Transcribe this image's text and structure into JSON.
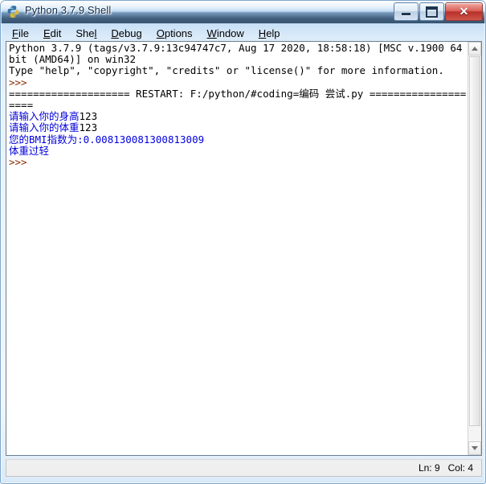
{
  "window": {
    "title": "Python 3.7.9 Shell",
    "icon": "python-logo-icon",
    "controls": {
      "minimize_label": "Minimize",
      "maximize_label": "Maximize",
      "close_label": "✕"
    }
  },
  "menubar": {
    "items": [
      {
        "name": "file",
        "pre": "",
        "key": "F",
        "post": "ile"
      },
      {
        "name": "edit",
        "pre": "",
        "key": "E",
        "post": "dit"
      },
      {
        "name": "shell",
        "pre": "She",
        "key": "l",
        "post": ""
      },
      {
        "name": "debug",
        "pre": "",
        "key": "D",
        "post": "ebug"
      },
      {
        "name": "options",
        "pre": "",
        "key": "O",
        "post": "ptions"
      },
      {
        "name": "window",
        "pre": "",
        "key": "W",
        "post": "indow"
      },
      {
        "name": "help",
        "pre": "",
        "key": "H",
        "post": "elp"
      }
    ]
  },
  "console": {
    "lines": [
      {
        "segments": [
          {
            "text": "Python 3.7.9 (tags/v3.7.9:13c94747c7, Aug 17 2020, 18:58:18) [MSC v.1900 64 bit (AMD64)] on win32",
            "color": "black"
          }
        ]
      },
      {
        "segments": [
          {
            "text": "Type \"help\", \"copyright\", \"credits\" or \"license()\" for more information.",
            "color": "black"
          }
        ]
      },
      {
        "segments": [
          {
            "text": ">>> ",
            "color": "prompt"
          }
        ]
      },
      {
        "segments": [
          {
            "text": "==================== RESTART: F:/python/#coding=编码 尝试.py ====================",
            "color": "black"
          }
        ]
      },
      {
        "segments": [
          {
            "text": "请输入你的身高",
            "color": "blue"
          },
          {
            "text": "123",
            "color": "black"
          }
        ]
      },
      {
        "segments": [
          {
            "text": "请输入你的体重",
            "color": "blue"
          },
          {
            "text": "123",
            "color": "black"
          }
        ]
      },
      {
        "segments": [
          {
            "text": "您的BMI指数为:0.008130081300813009",
            "color": "blue"
          }
        ]
      },
      {
        "segments": [
          {
            "text": "体重过轻",
            "color": "blue"
          }
        ]
      },
      {
        "segments": [
          {
            "text": ">>> ",
            "color": "prompt"
          }
        ]
      }
    ],
    "colors": {
      "stdout_black": "#000000",
      "prompt_maroon": "#8b2a00",
      "output_blue": "#0000dd",
      "background": "#ffffff"
    }
  },
  "scrollbar": {
    "up_arrow": "scroll-up-arrow-icon",
    "down_arrow": "scroll-down-arrow-icon"
  },
  "statusbar": {
    "line_label": "Ln: 9",
    "col_label": "Col: 4"
  }
}
